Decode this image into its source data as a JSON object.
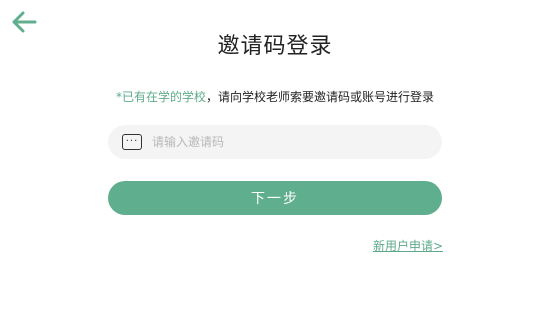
{
  "header": {
    "back_icon": "arrow-left-icon",
    "title": "邀请码登录"
  },
  "hint": {
    "accent_text": "*已有在学的学校",
    "rest_text": "，请向学校老师索要邀请码或账号进行登录"
  },
  "invite": {
    "icon": "keyboard-icon",
    "icon_glyph": "···",
    "value": "",
    "placeholder": "请输入邀请码"
  },
  "actions": {
    "next_label": "下一步",
    "new_user_label": "新用户申请>"
  },
  "colors": {
    "accent": "#5fae8d",
    "text": "#222222",
    "placeholder": "#b8b8b8",
    "input_bg": "#f4f4f4"
  }
}
